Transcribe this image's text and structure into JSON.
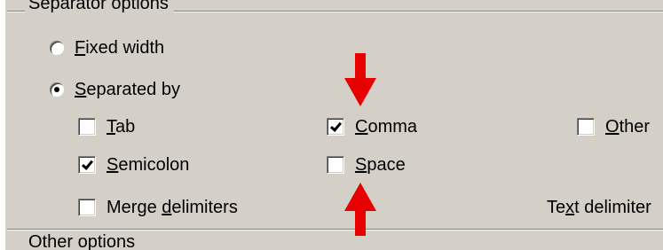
{
  "separator_options": {
    "title": "Separator options",
    "fixed_width": {
      "label_pre": "",
      "label_key": "F",
      "label_post": "ixed width",
      "checked": false
    },
    "separated_by": {
      "label_pre": "",
      "label_key": "S",
      "label_post": "eparated by",
      "checked": true
    },
    "tab": {
      "label_pre": "",
      "label_key": "T",
      "label_post": "ab",
      "checked": false
    },
    "comma": {
      "label_pre": "",
      "label_key": "C",
      "label_post": "omma",
      "checked": true
    },
    "other": {
      "label_pre": "",
      "label_key": "O",
      "label_post": "ther",
      "checked": false
    },
    "semicolon": {
      "label_pre": "",
      "label_key": "S",
      "label_post": "emicolon",
      "checked": true
    },
    "space": {
      "label_pre": "",
      "label_key": "S",
      "label_post": "pace",
      "checked": false
    },
    "merge": {
      "label_pre": "Merge ",
      "label_key": "d",
      "label_post": "elimiters",
      "checked": false
    },
    "text_delimiter": {
      "label_pre": "Te",
      "label_key": "x",
      "label_post": "t delimiter"
    }
  },
  "other_options": {
    "title": "Other options"
  },
  "annotations": {
    "arrow_color": "#e60000"
  }
}
